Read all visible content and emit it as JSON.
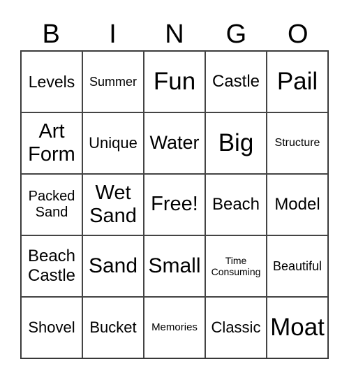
{
  "header": [
    "B",
    "I",
    "N",
    "G",
    "O"
  ],
  "cells": [
    "Levels",
    "Summer",
    "Fun",
    "Castle",
    "Pail",
    "Art Form",
    "Unique",
    "Water",
    "Big",
    "Structure",
    "Packed Sand",
    "Wet Sand",
    "Free!",
    "Beach",
    "Model",
    "Beach Castle",
    "Sand",
    "Small",
    "Time Consuming",
    "Beautiful",
    "Shovel",
    "Bucket",
    "Memories",
    "Classic",
    "Moat"
  ]
}
